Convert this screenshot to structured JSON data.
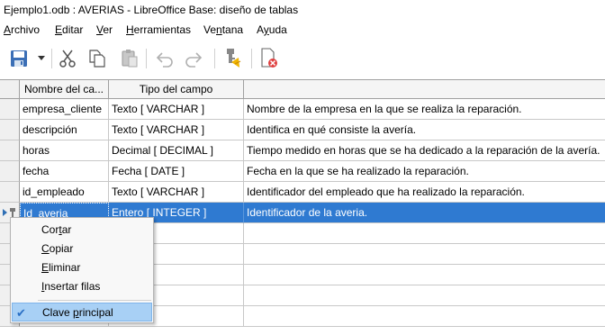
{
  "window": {
    "title": "Ejemplo1.odb : AVERIAS - LibreOffice Base: diseño de tablas"
  },
  "menubar": {
    "items": [
      {
        "pre": "",
        "ul": "A",
        "post": "rchivo"
      },
      {
        "pre": "",
        "ul": "E",
        "post": "ditar"
      },
      {
        "pre": "",
        "ul": "V",
        "post": "er"
      },
      {
        "pre": "",
        "ul": "H",
        "post": "erramientas"
      },
      {
        "pre": "Ve",
        "ul": "n",
        "post": "tana"
      },
      {
        "pre": "A",
        "ul": "y",
        "post": "uda"
      }
    ]
  },
  "toolbar": {
    "icons": [
      "save-icon",
      "dropdown-arrow-icon",
      "cut-icon",
      "copy-icon",
      "paste-icon",
      "undo-icon",
      "redo-icon",
      "primary-key-icon",
      "close-document-icon"
    ]
  },
  "table": {
    "headers": [
      "Nombre del ca...",
      "Tipo del campo",
      ""
    ],
    "rows": [
      {
        "name": "empresa_cliente",
        "type": "Texto [ VARCHAR ]",
        "desc": "Nombre de la empresa en la que se realiza la reparación."
      },
      {
        "name": "descripción",
        "type": "Texto [ VARCHAR ]",
        "desc": "Identifica en qué consiste la avería."
      },
      {
        "name": "horas",
        "type": "Decimal [ DECIMAL ]",
        "desc": "Tiempo medido en horas que se ha dedicado a la reparación de la avería."
      },
      {
        "name": "fecha",
        "type": "Fecha [ DATE ]",
        "desc": "Fecha en la que se ha realizado la reparación."
      },
      {
        "name": "id_empleado",
        "type": "Texto [ VARCHAR ]",
        "desc": "Identificador del empleado que ha realizado la reparación."
      },
      {
        "name": "Id_averia",
        "type": "Entero [ INTEGER ]",
        "desc": "Identificador de la averia."
      }
    ],
    "selected_row": 5
  },
  "context_menu": {
    "items": [
      {
        "pre": "Cor",
        "ul": "t",
        "post": "ar"
      },
      {
        "pre": "",
        "ul": "C",
        "post": "opiar"
      },
      {
        "pre": "",
        "ul": "E",
        "post": "liminar"
      },
      {
        "pre": "",
        "ul": "I",
        "post": "nsertar filas"
      },
      {
        "pre": "Clave ",
        "ul": "p",
        "post": "rincipal"
      }
    ],
    "checked_item": 4
  },
  "colors": {
    "selection": "#2f7ad1",
    "menu_highlight": "#a8d0f5"
  }
}
